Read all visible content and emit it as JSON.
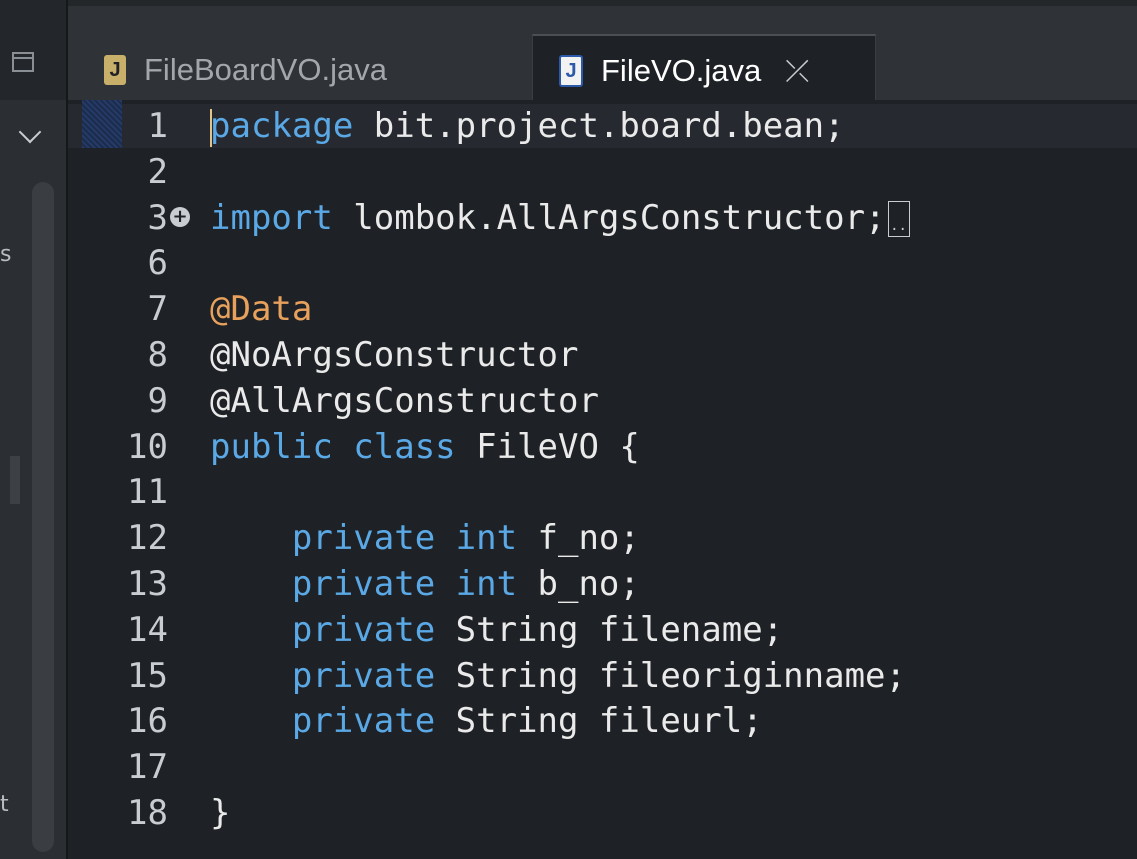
{
  "left_panel": {
    "chars": [
      "s",
      "t"
    ]
  },
  "tabs": [
    {
      "label": "FileBoardVO.java",
      "icon": "java-file-icon",
      "icon_letter": "J",
      "active": false
    },
    {
      "label": "FileVO.java",
      "icon": "java-file-icon",
      "icon_letter": "J",
      "active": true,
      "close_symbol": "⤫"
    }
  ],
  "editor": {
    "fold_symbol": "+",
    "collapsed_marker": "..",
    "lines": [
      {
        "num": "1",
        "tokens": [
          {
            "t": "package",
            "c": "kw"
          },
          {
            "t": " bit.project.board.bean;",
            "c": "plain"
          }
        ]
      },
      {
        "num": "2",
        "tokens": []
      },
      {
        "num": "3",
        "tokens": [
          {
            "t": "import",
            "c": "kw"
          },
          {
            "t": " lombok.AllArgsConstructor;",
            "c": "plain"
          }
        ]
      },
      {
        "num": "6",
        "tokens": []
      },
      {
        "num": "7",
        "tokens": [
          {
            "t": "@Data",
            "c": "ann"
          }
        ]
      },
      {
        "num": "8",
        "tokens": [
          {
            "t": "@NoArgsConstructor",
            "c": "plain"
          }
        ]
      },
      {
        "num": "9",
        "tokens": [
          {
            "t": "@AllArgsConstructor",
            "c": "plain"
          }
        ]
      },
      {
        "num": "10",
        "tokens": [
          {
            "t": "public class",
            "c": "kw"
          },
          {
            "t": " FileVO {",
            "c": "plain"
          }
        ]
      },
      {
        "num": "11",
        "tokens": []
      },
      {
        "num": "12",
        "tokens": [
          {
            "t": "    private int",
            "c": "kw"
          },
          {
            "t": " f_no;",
            "c": "plain"
          }
        ]
      },
      {
        "num": "13",
        "tokens": [
          {
            "t": "    private int",
            "c": "kw"
          },
          {
            "t": " b_no;",
            "c": "plain"
          }
        ]
      },
      {
        "num": "14",
        "tokens": [
          {
            "t": "    private",
            "c": "kw"
          },
          {
            "t": " String filename;",
            "c": "plain"
          }
        ]
      },
      {
        "num": "15",
        "tokens": [
          {
            "t": "    private",
            "c": "kw"
          },
          {
            "t": " String fileoriginname;",
            "c": "plain"
          }
        ]
      },
      {
        "num": "16",
        "tokens": [
          {
            "t": "    private",
            "c": "kw"
          },
          {
            "t": " String fileurl;",
            "c": "plain"
          }
        ]
      },
      {
        "num": "17",
        "tokens": []
      },
      {
        "num": "18",
        "tokens": [
          {
            "t": "}",
            "c": "plain"
          }
        ]
      }
    ]
  },
  "colors": {
    "keyword": "#5aa9e6",
    "annotation": "#e8a15d",
    "text": "#eaeaea",
    "background": "#1e2125"
  }
}
